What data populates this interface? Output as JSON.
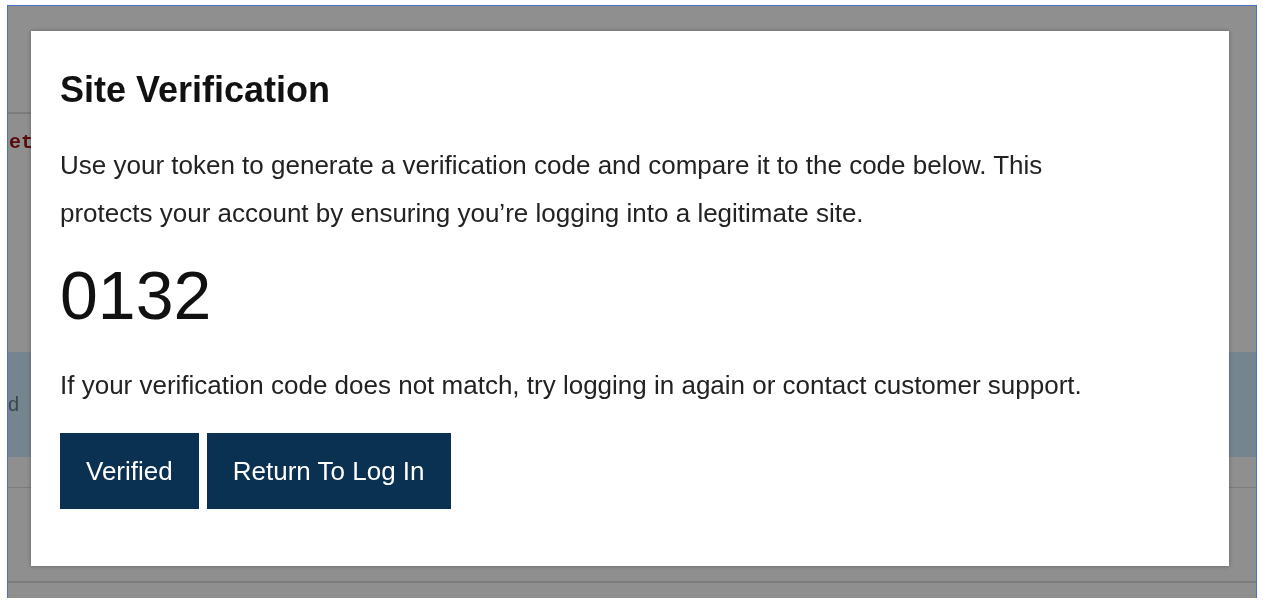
{
  "background": {
    "heading_fragment": "et",
    "notice_fragment": "d"
  },
  "dialog": {
    "title": "Site Verification",
    "description": "Use your token to generate a verification code and compare it to the code below. This protects your account by ensuring you’re logging into a legitimate site.",
    "code": "0132",
    "hint": "If your verification code does not match, try logging in again or contact customer support.",
    "buttons": [
      {
        "label": "Verified"
      },
      {
        "label": "Return To Log In"
      }
    ]
  }
}
